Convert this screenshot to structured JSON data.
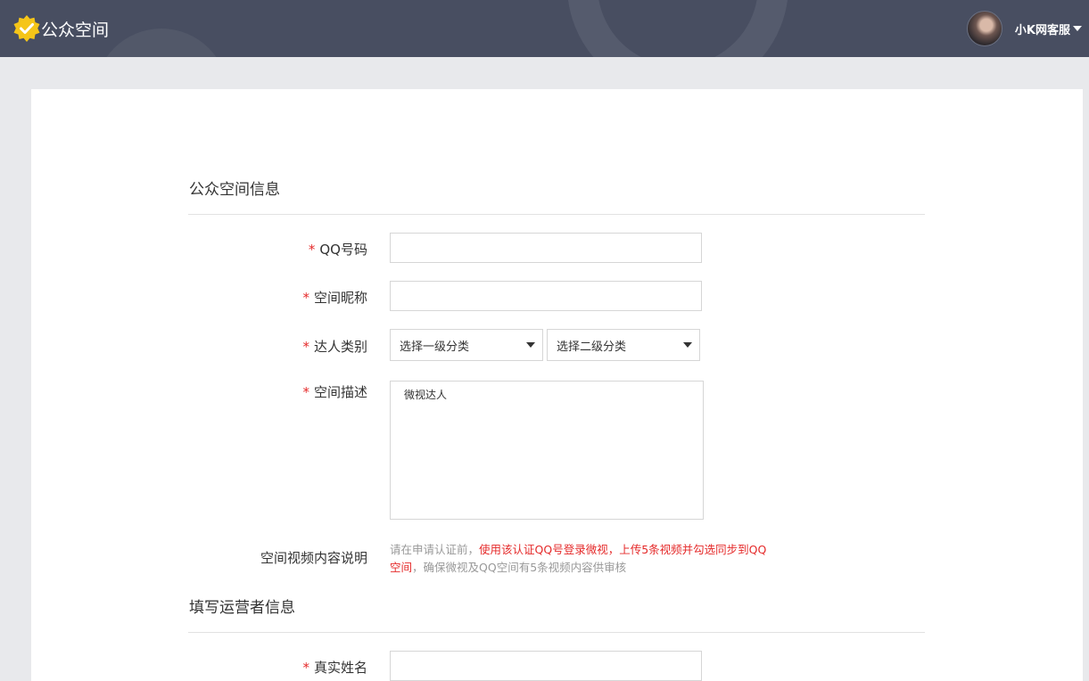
{
  "app": {
    "title": "公众空间",
    "user_name": "小K网客服"
  },
  "colors": {
    "header_bg": "#484e61",
    "accent_yellow": "#f5c518",
    "required_red": "#e52a2a"
  },
  "icons": {
    "logo": "badge-check-icon",
    "user_menu": "caret-down-icon"
  },
  "sections": {
    "space_info": "公众空间信息",
    "operator_info": "填写运营者信息"
  },
  "form": {
    "required_mark": "*",
    "qq": {
      "label": "QQ号码",
      "value": ""
    },
    "nickname": {
      "label": "空间昵称",
      "value": ""
    },
    "category": {
      "label": "达人类别",
      "primary_selected": "选择一级分类",
      "secondary_selected": "选择二级分类"
    },
    "description": {
      "label": "空间描述",
      "value": "微视达人"
    },
    "video_note": {
      "label": "空间视频内容说明",
      "part1": "请在申请认证前，",
      "part2": "使用该认证QQ号登录微视，上传5条视频并勾选同步到QQ空间",
      "part3": "，确保微视及QQ空间有5条视频内容供审核"
    },
    "real_name": {
      "label": "真实姓名",
      "value": ""
    }
  }
}
